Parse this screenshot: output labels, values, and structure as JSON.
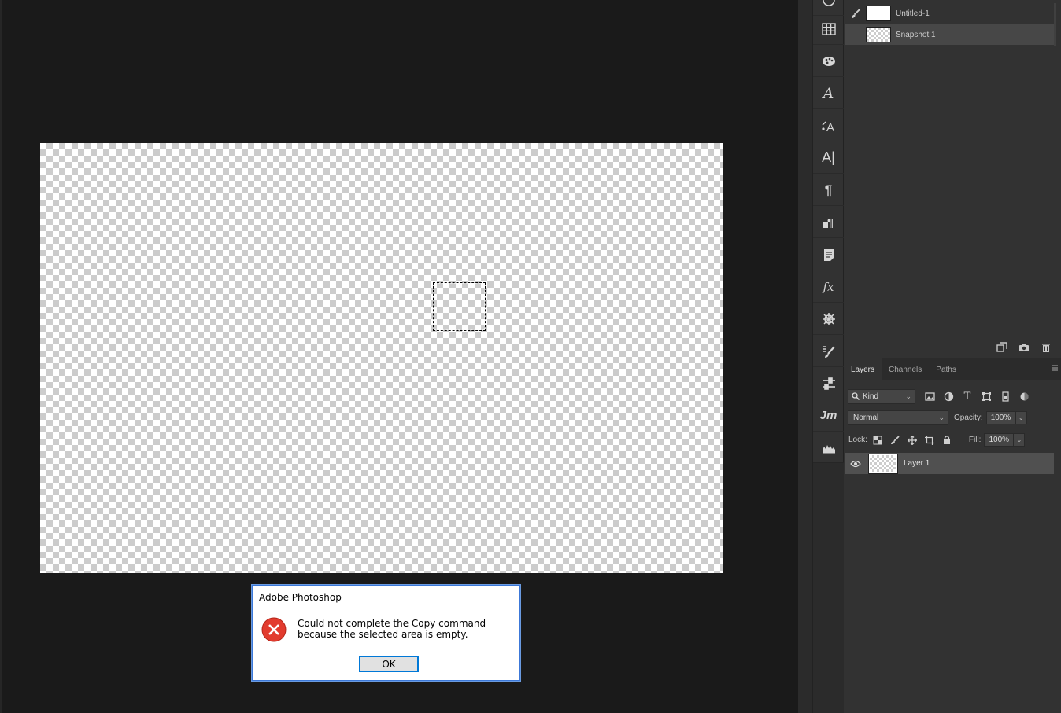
{
  "history": {
    "items": [
      {
        "label": "Untitled-1",
        "thumb": "white",
        "icon": "history-brush-icon"
      },
      {
        "label": "Snapshot 1",
        "thumb": "transparent",
        "selected": true
      }
    ]
  },
  "layers_panel": {
    "tabs": [
      {
        "label": "Layers",
        "active": true
      },
      {
        "label": "Channels",
        "active": false
      },
      {
        "label": "Paths",
        "active": false
      }
    ],
    "filter": {
      "kind_label": "Kind"
    },
    "blend_mode": "Normal",
    "opacity_label": "Opacity:",
    "opacity_value": "100%",
    "lock_label": "Lock:",
    "fill_label": "Fill:",
    "fill_value": "100%",
    "layers": [
      {
        "name": "Layer 1",
        "visible": true
      }
    ]
  },
  "dialog": {
    "title": "Adobe Photoshop",
    "message": "Could not complete the Copy command because the selected area is empty.",
    "ok_label": "OK",
    "icon": "error-icon",
    "icon_color": "#e23b2e"
  },
  "toolbar_icons": [
    "grid-icon",
    "paint-palette-icon",
    "character-style-icon",
    "glyphs-icon",
    "character-icon",
    "paragraph-icon",
    "paragraph-style-icon",
    "notes-icon",
    "styles-fx-icon",
    "adjustments-icon",
    "brush-settings-icon",
    "properties-icon",
    "libraries-jm-icon",
    "histogram-icon"
  ],
  "colors": {
    "workspace": "#1a1a1a",
    "panel": "#323232",
    "accent_blue": "#0078d7"
  }
}
